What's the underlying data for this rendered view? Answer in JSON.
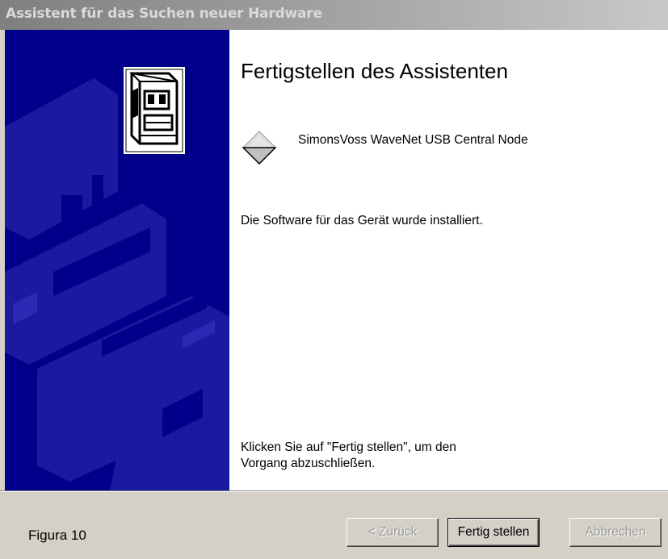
{
  "window": {
    "title": "Assistent für das Suchen neuer Hardware"
  },
  "content": {
    "heading": "Fertigstellen des Assistenten",
    "device_icon": "generic-device-icon",
    "device_name": "SimonsVoss WaveNet USB Central Node",
    "status": "Die Software für das Gerät wurde installiert.",
    "instruction_line1": "Klicken Sie auf \"Fertig stellen\", um den",
    "instruction_line2": "Vorgang abzuschließen."
  },
  "side_panel": {
    "background": "#00008a",
    "icon": "hardware-wizard-icon"
  },
  "footer": {
    "caption": "Figura 10"
  },
  "buttons": {
    "back": {
      "label": "< Zurück",
      "enabled": false
    },
    "finish": {
      "label": "Fertig stellen",
      "enabled": true,
      "default": true
    },
    "cancel": {
      "label": "Abbrechen",
      "enabled": false
    }
  }
}
